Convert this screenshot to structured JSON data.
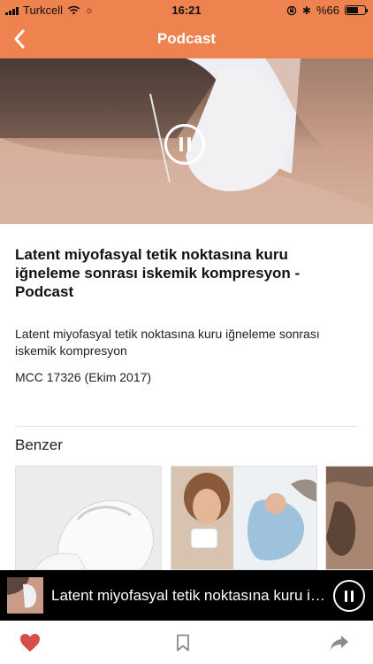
{
  "status_bar": {
    "carrier": "Turkcell",
    "time": "16:21",
    "battery": "%66",
    "battery_level": 0.66,
    "icons": [
      "signal-icon",
      "wifi-icon",
      "brightness-icon",
      "orientation-lock-icon",
      "bluetooth-icon",
      "battery-icon"
    ]
  },
  "nav": {
    "title": "Podcast",
    "back_icon": "chevron-left-icon"
  },
  "colors": {
    "header": "#ef8350",
    "favorite": "#d94c4c",
    "toolbar_icon": "#8a8a8a",
    "mini_player": "#000000"
  },
  "hero": {
    "icon": "pause-icon"
  },
  "article": {
    "title": "Latent miyofasyal tetik noktasına kuru iğneleme sonrası iskemik kompresyon - Podcast",
    "description": "Latent miyofasyal tetik noktasına kuru iğneleme sonrası iskemik kompresyon",
    "reference": "MCC 17326 (Ekim 2017)"
  },
  "related": {
    "title": "Benzer"
  },
  "mini_player": {
    "title": "Latent miyofasyal tetik noktasına kuru iğneleme sonrası iskemik kompresyon - Podcast",
    "icon": "pause-icon"
  },
  "toolbar": {
    "icons": [
      "heart-icon",
      "bookmark-icon",
      "share-icon"
    ]
  }
}
